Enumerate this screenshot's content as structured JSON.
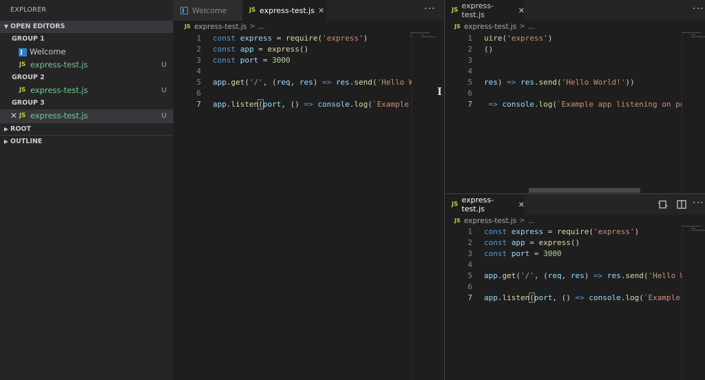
{
  "explorer": {
    "title": "EXPLORER",
    "open_editors": {
      "label": "OPEN EDITORS",
      "groups": [
        {
          "label": "GROUP 1",
          "files": [
            {
              "name": "Welcome",
              "badge": ""
            },
            {
              "name": "express-test.js",
              "badge": "U"
            }
          ]
        },
        {
          "label": "GROUP 2",
          "files": [
            {
              "name": "express-test.js",
              "badge": "U"
            }
          ]
        },
        {
          "label": "GROUP 3",
          "files": [
            {
              "name": "express-test.js",
              "badge": "U",
              "close": "✕"
            }
          ]
        }
      ]
    },
    "sections": [
      {
        "label": "ROOT"
      },
      {
        "label": "OUTLINE"
      }
    ]
  },
  "icons": {
    "js": "JS",
    "more": "···",
    "breadcrumb_sep": ">",
    "ellipsis": "...",
    "close": "✕"
  },
  "editor1": {
    "tabs": [
      {
        "label": "Welcome"
      },
      {
        "label": "express-test.js"
      }
    ],
    "breadcrumb": {
      "file": "express-test.js"
    }
  },
  "editor2": {
    "tab": {
      "label": "express-test.js"
    },
    "breadcrumb": {
      "file": "express-test.js"
    }
  },
  "editor3": {
    "tab": {
      "label": "express-test.js"
    },
    "breadcrumb": {
      "file": "express-test.js"
    }
  },
  "code_full": [
    {
      "n": "1",
      "tokens": [
        [
          "kw",
          "const "
        ],
        [
          "var",
          "express"
        ],
        [
          "plain",
          " = "
        ],
        [
          "fn",
          "require"
        ],
        [
          "plain",
          "("
        ],
        [
          "str",
          "'express'"
        ],
        [
          "plain",
          ")"
        ]
      ]
    },
    {
      "n": "2",
      "tokens": [
        [
          "kw",
          "const "
        ],
        [
          "var",
          "app"
        ],
        [
          "plain",
          " = "
        ],
        [
          "fn",
          "express"
        ],
        [
          "plain",
          "()"
        ]
      ]
    },
    {
      "n": "3",
      "tokens": [
        [
          "kw",
          "const "
        ],
        [
          "var",
          "port"
        ],
        [
          "plain",
          " = "
        ],
        [
          "num",
          "3000"
        ]
      ]
    },
    {
      "n": "4",
      "tokens": []
    },
    {
      "n": "5",
      "tokens": [
        [
          "var",
          "app"
        ],
        [
          "plain",
          "."
        ],
        [
          "fn",
          "get"
        ],
        [
          "plain",
          "("
        ],
        [
          "str",
          "'/'"
        ],
        [
          "plain",
          ", ("
        ],
        [
          "var",
          "req"
        ],
        [
          "plain",
          ", "
        ],
        [
          "var",
          "res"
        ],
        [
          "plain",
          ") "
        ],
        [
          "kw",
          "=>"
        ],
        [
          "plain",
          " "
        ],
        [
          "var",
          "res"
        ],
        [
          "plain",
          "."
        ],
        [
          "fn",
          "send"
        ],
        [
          "plain",
          "("
        ],
        [
          "str",
          "'Hello World!'"
        ],
        [
          "plain",
          "))"
        ]
      ]
    },
    {
      "n": "6",
      "tokens": []
    },
    {
      "n": "7",
      "tokens": [
        [
          "var",
          "app"
        ],
        [
          "plain",
          "."
        ],
        [
          "fn",
          "listen"
        ],
        [
          "plain",
          "("
        ],
        [
          "var",
          "port"
        ],
        [
          "plain",
          ", () "
        ],
        [
          "kw",
          "=>"
        ],
        [
          "plain",
          " "
        ],
        [
          "var",
          "console"
        ],
        [
          "plain",
          "."
        ],
        [
          "fn",
          "log"
        ],
        [
          "plain",
          "("
        ],
        [
          "str",
          "`Example app listening on port ${port}!`"
        ],
        [
          "plain",
          "))"
        ]
      ]
    }
  ],
  "code_scrolled": [
    {
      "n": "1",
      "tokens": [
        [
          "fn",
          "uire"
        ],
        [
          "plain",
          "("
        ],
        [
          "str",
          "'express'"
        ],
        [
          "plain",
          ")"
        ]
      ]
    },
    {
      "n": "2",
      "tokens": [
        [
          "plain",
          "()"
        ]
      ]
    },
    {
      "n": "3",
      "tokens": []
    },
    {
      "n": "4",
      "tokens": []
    },
    {
      "n": "5",
      "tokens": [
        [
          "var",
          "res"
        ],
        [
          "plain",
          ") "
        ],
        [
          "kw",
          "=>"
        ],
        [
          "plain",
          " "
        ],
        [
          "var",
          "res"
        ],
        [
          "plain",
          "."
        ],
        [
          "fn",
          "send"
        ],
        [
          "plain",
          "("
        ],
        [
          "str",
          "'Hello World!'"
        ],
        [
          "plain",
          "))"
        ]
      ]
    },
    {
      "n": "6",
      "tokens": []
    },
    {
      "n": "7",
      "tokens": [
        [
          "plain",
          " "
        ],
        [
          "kw",
          "=>"
        ],
        [
          "plain",
          " "
        ],
        [
          "var",
          "console"
        ],
        [
          "plain",
          "."
        ],
        [
          "fn",
          "log"
        ],
        [
          "plain",
          "("
        ],
        [
          "str",
          "`Example app listening on port ${port}!`"
        ],
        [
          "plain",
          "))"
        ]
      ]
    }
  ],
  "current_line": "7",
  "drag_cursor": "I"
}
